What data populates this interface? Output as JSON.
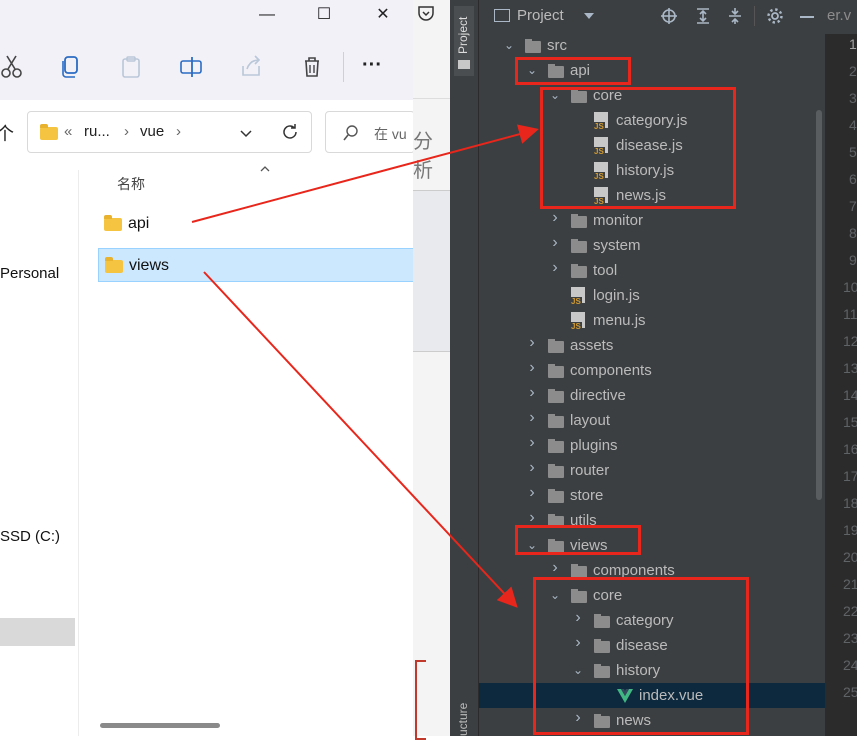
{
  "explorer": {
    "window_controls": [
      "—",
      "☐",
      "✕"
    ],
    "toolbar_icons": [
      "cut-icon",
      "copy-icon",
      "paste-icon",
      "rename-icon",
      "share-icon",
      "delete-icon"
    ],
    "more_label": "···",
    "up_label": "个",
    "breadcrumb": {
      "overflow": "«",
      "parent": "ru...",
      "sep1": "›",
      "current": "vue",
      "sep2": "›"
    },
    "search_placeholder": "在 vu",
    "column_header": "名称",
    "sidebar": {
      "personal": "Personal",
      "drive": "SSD (C:)"
    },
    "files": [
      {
        "name": "api",
        "selected": false
      },
      {
        "name": "views",
        "selected": true
      }
    ],
    "behind_text": "分析"
  },
  "ide": {
    "side_tab": "Project",
    "side_tab_bottom": "ucture",
    "header_title": "Project",
    "editor_tab_partial": "er.v",
    "line_numbers": [
      "1",
      "2",
      "3",
      "4",
      "5",
      "6",
      "7",
      "8",
      "9",
      "10",
      "11",
      "12",
      "13",
      "14",
      "15",
      "16",
      "17",
      "18",
      "19",
      "20",
      "21",
      "22",
      "23",
      "24",
      "25"
    ],
    "tree": [
      {
        "label": "src",
        "depth": 0,
        "type": "folder",
        "open": true
      },
      {
        "label": "api",
        "depth": 1,
        "type": "folder",
        "open": true,
        "highlight": true
      },
      {
        "label": "core",
        "depth": 2,
        "type": "folder",
        "open": true
      },
      {
        "label": "category.js",
        "depth": 3,
        "type": "js"
      },
      {
        "label": "disease.js",
        "depth": 3,
        "type": "js"
      },
      {
        "label": "history.js",
        "depth": 3,
        "type": "js"
      },
      {
        "label": "news.js",
        "depth": 3,
        "type": "js"
      },
      {
        "label": "monitor",
        "depth": 2,
        "type": "folder",
        "open": false
      },
      {
        "label": "system",
        "depth": 2,
        "type": "folder",
        "open": false
      },
      {
        "label": "tool",
        "depth": 2,
        "type": "folder",
        "open": false
      },
      {
        "label": "login.js",
        "depth": 2,
        "type": "js"
      },
      {
        "label": "menu.js",
        "depth": 2,
        "type": "js"
      },
      {
        "label": "assets",
        "depth": 1,
        "type": "folder",
        "open": false
      },
      {
        "label": "components",
        "depth": 1,
        "type": "folder",
        "open": false
      },
      {
        "label": "directive",
        "depth": 1,
        "type": "folder",
        "open": false
      },
      {
        "label": "layout",
        "depth": 1,
        "type": "folder",
        "open": false
      },
      {
        "label": "plugins",
        "depth": 1,
        "type": "folder",
        "open": false
      },
      {
        "label": "router",
        "depth": 1,
        "type": "folder",
        "open": false
      },
      {
        "label": "store",
        "depth": 1,
        "type": "folder",
        "open": false
      },
      {
        "label": "utils",
        "depth": 1,
        "type": "folder",
        "open": false
      },
      {
        "label": "views",
        "depth": 1,
        "type": "folder",
        "open": true
      },
      {
        "label": "components",
        "depth": 2,
        "type": "folder",
        "open": false
      },
      {
        "label": "core",
        "depth": 2,
        "type": "folder",
        "open": true
      },
      {
        "label": "category",
        "depth": 3,
        "type": "folder",
        "open": false
      },
      {
        "label": "disease",
        "depth": 3,
        "type": "folder",
        "open": false
      },
      {
        "label": "history",
        "depth": 3,
        "type": "folder",
        "open": true
      },
      {
        "label": "index.vue",
        "depth": 4,
        "type": "vue",
        "selected": true
      },
      {
        "label": "news",
        "depth": 3,
        "type": "folder",
        "open": false
      }
    ]
  },
  "colors": {
    "annotation_red": "#e8261b",
    "ide_bg": "#3c3f41",
    "folder_yellow": "#f5c542",
    "selection_blue": "#cce8ff"
  }
}
